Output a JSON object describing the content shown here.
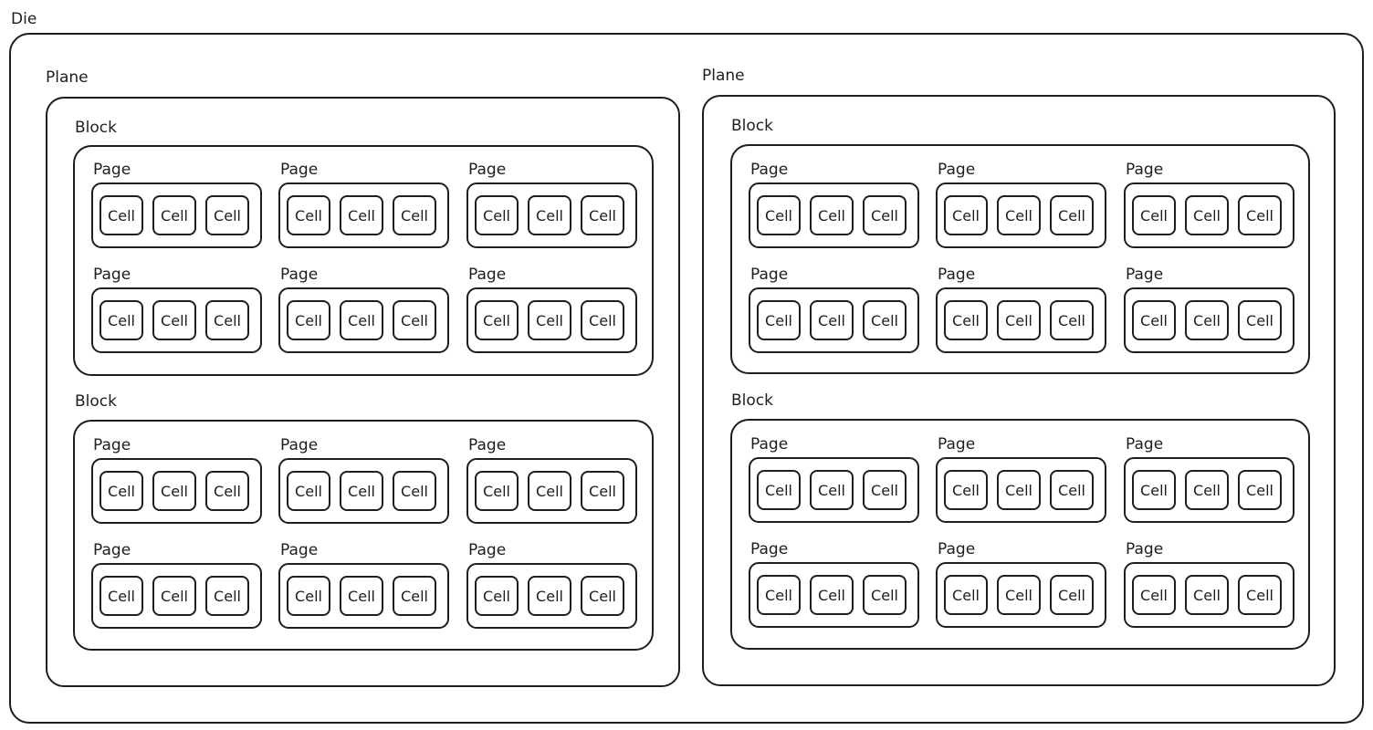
{
  "diagram": {
    "die": {
      "label": "Die"
    },
    "planes": [
      {
        "label": "Plane",
        "blocks": [
          {
            "label": "Block",
            "pages": [
              {
                "label": "Page",
                "cells": [
                  "Cell",
                  "Cell",
                  "Cell"
                ]
              },
              {
                "label": "Page",
                "cells": [
                  "Cell",
                  "Cell",
                  "Cell"
                ]
              },
              {
                "label": "Page",
                "cells": [
                  "Cell",
                  "Cell",
                  "Cell"
                ]
              },
              {
                "label": "Page",
                "cells": [
                  "Cell",
                  "Cell",
                  "Cell"
                ]
              },
              {
                "label": "Page",
                "cells": [
                  "Cell",
                  "Cell",
                  "Cell"
                ]
              },
              {
                "label": "Page",
                "cells": [
                  "Cell",
                  "Cell",
                  "Cell"
                ]
              }
            ]
          },
          {
            "label": "Block",
            "pages": [
              {
                "label": "Page",
                "cells": [
                  "Cell",
                  "Cell",
                  "Cell"
                ]
              },
              {
                "label": "Page",
                "cells": [
                  "Cell",
                  "Cell",
                  "Cell"
                ]
              },
              {
                "label": "Page",
                "cells": [
                  "Cell",
                  "Cell",
                  "Cell"
                ]
              },
              {
                "label": "Page",
                "cells": [
                  "Cell",
                  "Cell",
                  "Cell"
                ]
              },
              {
                "label": "Page",
                "cells": [
                  "Cell",
                  "Cell",
                  "Cell"
                ]
              },
              {
                "label": "Page",
                "cells": [
                  "Cell",
                  "Cell",
                  "Cell"
                ]
              }
            ]
          }
        ]
      },
      {
        "label": "Plane",
        "blocks": [
          {
            "label": "Block",
            "pages": [
              {
                "label": "Page",
                "cells": [
                  "Cell",
                  "Cell",
                  "Cell"
                ]
              },
              {
                "label": "Page",
                "cells": [
                  "Cell",
                  "Cell",
                  "Cell"
                ]
              },
              {
                "label": "Page",
                "cells": [
                  "Cell",
                  "Cell",
                  "Cell"
                ]
              },
              {
                "label": "Page",
                "cells": [
                  "Cell",
                  "Cell",
                  "Cell"
                ]
              },
              {
                "label": "Page",
                "cells": [
                  "Cell",
                  "Cell",
                  "Cell"
                ]
              },
              {
                "label": "Page",
                "cells": [
                  "Cell",
                  "Cell",
                  "Cell"
                ]
              }
            ]
          },
          {
            "label": "Block",
            "pages": [
              {
                "label": "Page",
                "cells": [
                  "Cell",
                  "Cell",
                  "Cell"
                ]
              },
              {
                "label": "Page",
                "cells": [
                  "Cell",
                  "Cell",
                  "Cell"
                ]
              },
              {
                "label": "Page",
                "cells": [
                  "Cell",
                  "Cell",
                  "Cell"
                ]
              },
              {
                "label": "Page",
                "cells": [
                  "Cell",
                  "Cell",
                  "Cell"
                ]
              },
              {
                "label": "Page",
                "cells": [
                  "Cell",
                  "Cell",
                  "Cell"
                ]
              },
              {
                "label": "Page",
                "cells": [
                  "Cell",
                  "Cell",
                  "Cell"
                ]
              }
            ]
          }
        ]
      }
    ]
  },
  "colors": {
    "stroke": "#1e1e1e",
    "background": "#ffffff"
  }
}
